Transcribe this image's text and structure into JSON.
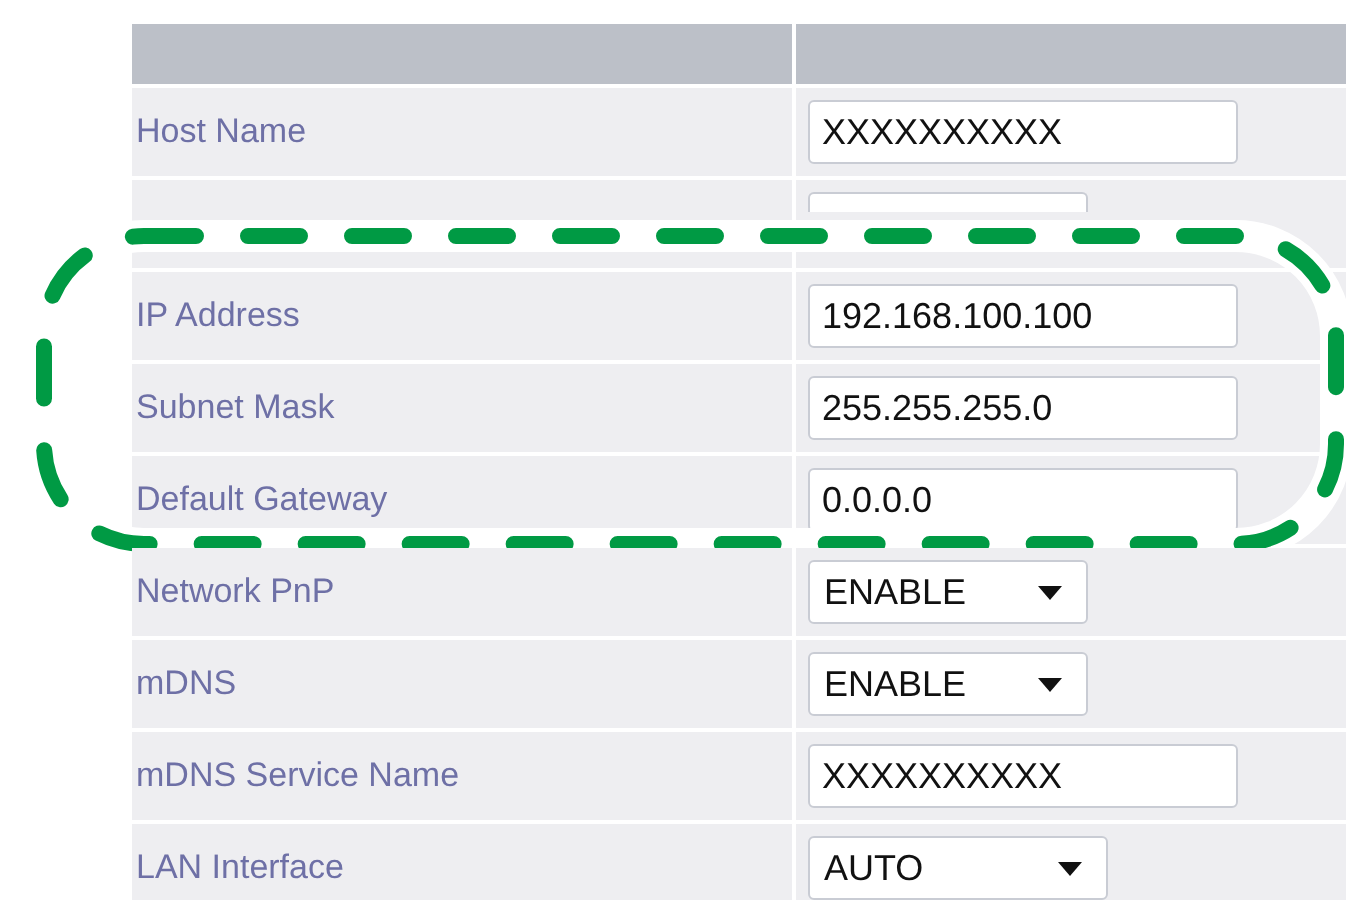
{
  "groups": [
    {
      "highlighted": false,
      "rows": [
        {
          "label": "Host Name",
          "kind": "text",
          "value": "XXXXXXXXXX"
        },
        {
          "kind": "select"
        }
      ]
    },
    {
      "highlighted": true,
      "rows": [
        {
          "label": "IP Address",
          "kind": "text",
          "value": "192.168.100.100"
        },
        {
          "label": "Subnet Mask",
          "kind": "text",
          "value": "255.255.255.0"
        },
        {
          "label": "Default Gateway",
          "kind": "text",
          "value": "0.0.0.0"
        }
      ]
    },
    {
      "highlighted": false,
      "rows": [
        {
          "label": "Network PnP",
          "kind": "select",
          "value": "ENABLE"
        },
        {
          "label": "mDNS",
          "kind": "select",
          "value": "ENABLE"
        },
        {
          "label": "mDNS Service Name",
          "kind": "text",
          "value": "XXXXXXXXXX"
        },
        {
          "label": "LAN Interface",
          "kind": "select",
          "value": "AUTO"
        }
      ]
    }
  ]
}
